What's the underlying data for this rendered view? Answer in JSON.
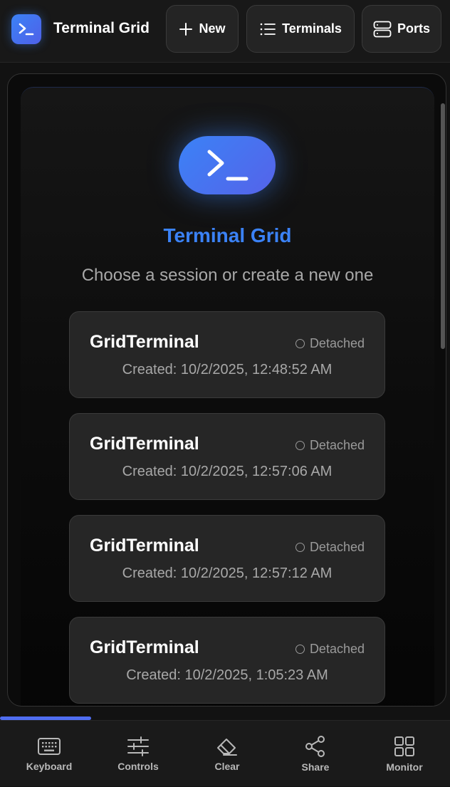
{
  "header": {
    "app_title": "Terminal Grid",
    "buttons": {
      "new": "New",
      "terminals": "Terminals",
      "ports": "Ports"
    }
  },
  "main": {
    "title": "Terminal Grid",
    "subtitle": "Choose a session or create a new one",
    "sessions": [
      {
        "name": "GridTerminal",
        "status": "Detached",
        "created": "Created: 10/2/2025, 12:48:52 AM"
      },
      {
        "name": "GridTerminal",
        "status": "Detached",
        "created": "Created: 10/2/2025, 12:57:06 AM"
      },
      {
        "name": "GridTerminal",
        "status": "Detached",
        "created": "Created: 10/2/2025, 12:57:12 AM"
      },
      {
        "name": "GridTerminal",
        "status": "Detached",
        "created": "Created: 10/2/2025, 1:05:23 AM"
      }
    ]
  },
  "bottom_bar": {
    "tabs": [
      {
        "label": "Keyboard",
        "icon": "keyboard-icon"
      },
      {
        "label": "Controls",
        "icon": "sliders-icon"
      },
      {
        "label": "Clear",
        "icon": "eraser-icon"
      },
      {
        "label": "Share",
        "icon": "share-icon"
      },
      {
        "label": "Monitor",
        "icon": "grid-icon"
      }
    ]
  },
  "colors": {
    "accent": "#3b82f6",
    "background": "#121212",
    "card": "#262626"
  }
}
